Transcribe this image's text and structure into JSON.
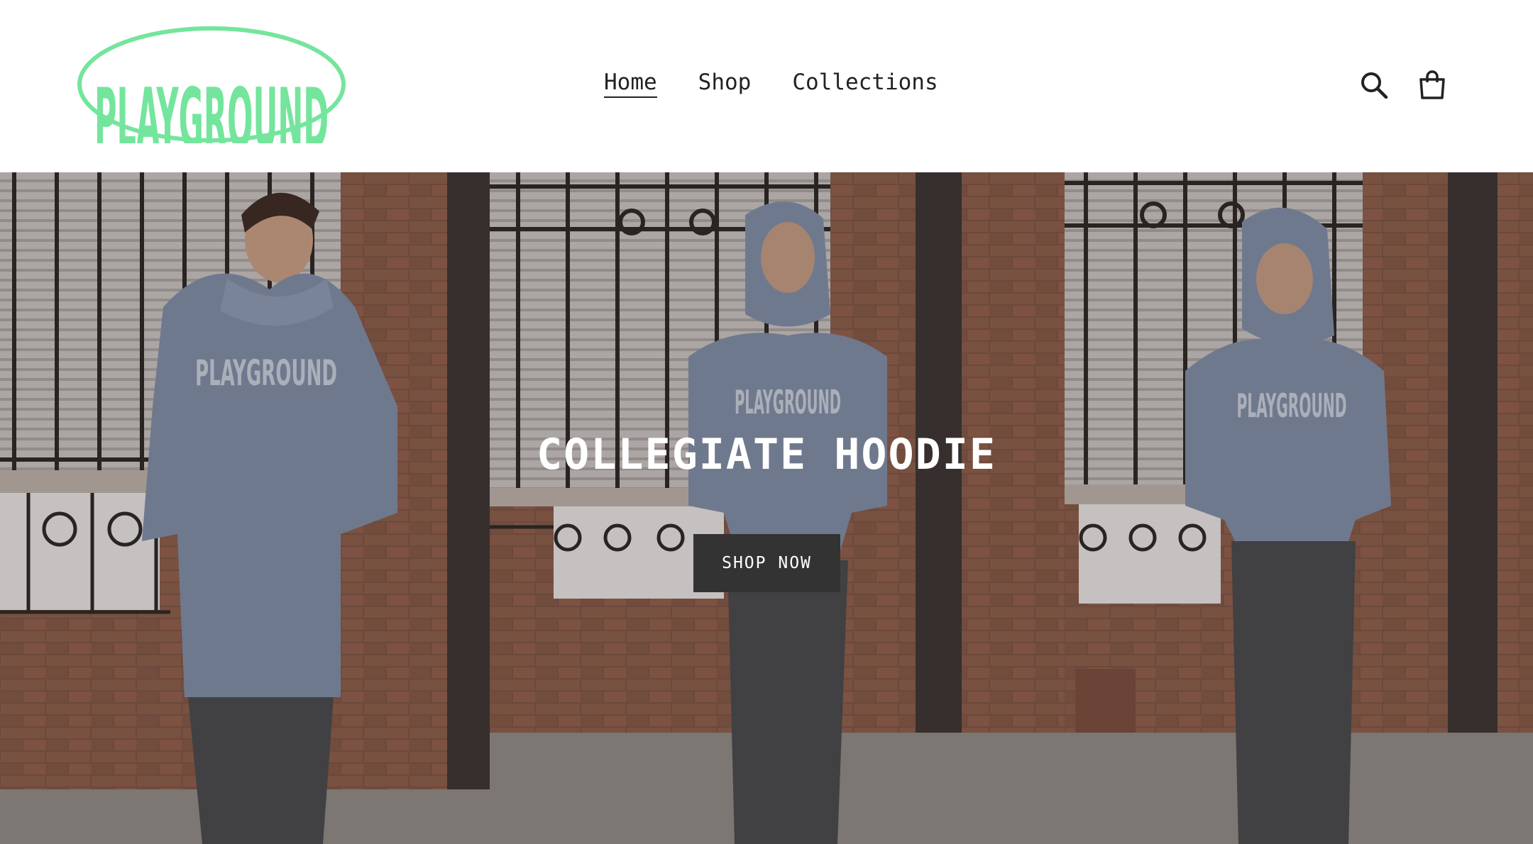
{
  "brand": {
    "logo_text": "PLAYGROUND",
    "logo_color": "#74e59c"
  },
  "nav": {
    "items": [
      {
        "label": "Home",
        "active": true
      },
      {
        "label": "Shop",
        "active": false
      },
      {
        "label": "Collections",
        "active": false
      }
    ]
  },
  "header_icons": {
    "search": "search-icon",
    "cart": "cart-icon"
  },
  "hero": {
    "title": "COLLEGIATE HOODIE",
    "button_label": "SHOP NOW",
    "button_color": "#333333",
    "hoodie_print": "PLAYGROUND"
  }
}
